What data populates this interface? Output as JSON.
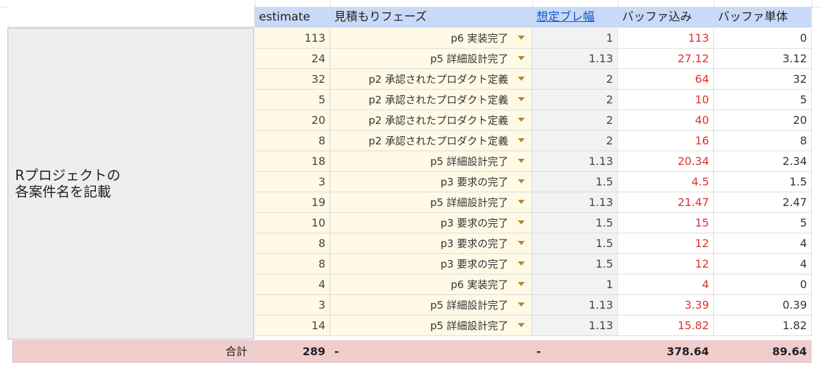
{
  "header": {
    "col_estimate": "estimate",
    "col_phase": "見積もりフェーズ",
    "col_variance": "想定ブレ幅",
    "col_buffered": "バッファ込み",
    "col_buffer_only": "バッファ単体"
  },
  "side_label": "Rプロジェクトの\n各案件名を記載",
  "rows": [
    {
      "estimate": "113",
      "phase": "p6 実装完了",
      "variance": "1",
      "buffered": "113",
      "buffer_only": "0"
    },
    {
      "estimate": "24",
      "phase": "p5 詳細設計完了",
      "variance": "1.13",
      "buffered": "27.12",
      "buffer_only": "3.12"
    },
    {
      "estimate": "32",
      "phase": "p2 承認されたプロダクト定義",
      "variance": "2",
      "buffered": "64",
      "buffer_only": "32"
    },
    {
      "estimate": "5",
      "phase": "p2 承認されたプロダクト定義",
      "variance": "2",
      "buffered": "10",
      "buffer_only": "5"
    },
    {
      "estimate": "20",
      "phase": "p2 承認されたプロダクト定義",
      "variance": "2",
      "buffered": "40",
      "buffer_only": "20"
    },
    {
      "estimate": "8",
      "phase": "p2 承認されたプロダクト定義",
      "variance": "2",
      "buffered": "16",
      "buffer_only": "8"
    },
    {
      "estimate": "18",
      "phase": "p5 詳細設計完了",
      "variance": "1.13",
      "buffered": "20.34",
      "buffer_only": "2.34"
    },
    {
      "estimate": "3",
      "phase": "p3 要求の完了",
      "variance": "1.5",
      "buffered": "4.5",
      "buffer_only": "1.5"
    },
    {
      "estimate": "19",
      "phase": "p5 詳細設計完了",
      "variance": "1.13",
      "buffered": "21.47",
      "buffer_only": "2.47"
    },
    {
      "estimate": "10",
      "phase": "p3 要求の完了",
      "variance": "1.5",
      "buffered": "15",
      "buffer_only": "5"
    },
    {
      "estimate": "8",
      "phase": "p3 要求の完了",
      "variance": "1.5",
      "buffered": "12",
      "buffer_only": "4"
    },
    {
      "estimate": "8",
      "phase": "p3 要求の完了",
      "variance": "1.5",
      "buffered": "12",
      "buffer_only": "4"
    },
    {
      "estimate": "4",
      "phase": "p6 実装完了",
      "variance": "1",
      "buffered": "4",
      "buffer_only": "0"
    },
    {
      "estimate": "3",
      "phase": "p5 詳細設計完了",
      "variance": "1.13",
      "buffered": "3.39",
      "buffer_only": "0.39"
    },
    {
      "estimate": "14",
      "phase": "p5 詳細設計完了",
      "variance": "1.13",
      "buffered": "15.82",
      "buffer_only": "1.82"
    }
  ],
  "total": {
    "label": "合計",
    "estimate": "289",
    "phase": "-",
    "variance": "-",
    "buffered": "378.64",
    "buffer_only": "89.64"
  },
  "colors": {
    "header_bg": "#c9daf8",
    "estimate_bg": "#fff9e6",
    "variance_bg": "#f2f2f2",
    "buffered_text": "#e0302b",
    "total_bg": "#f1cccc",
    "link": "#1155cc"
  },
  "icons": {
    "dropdown": "dropdown-arrow-icon"
  }
}
